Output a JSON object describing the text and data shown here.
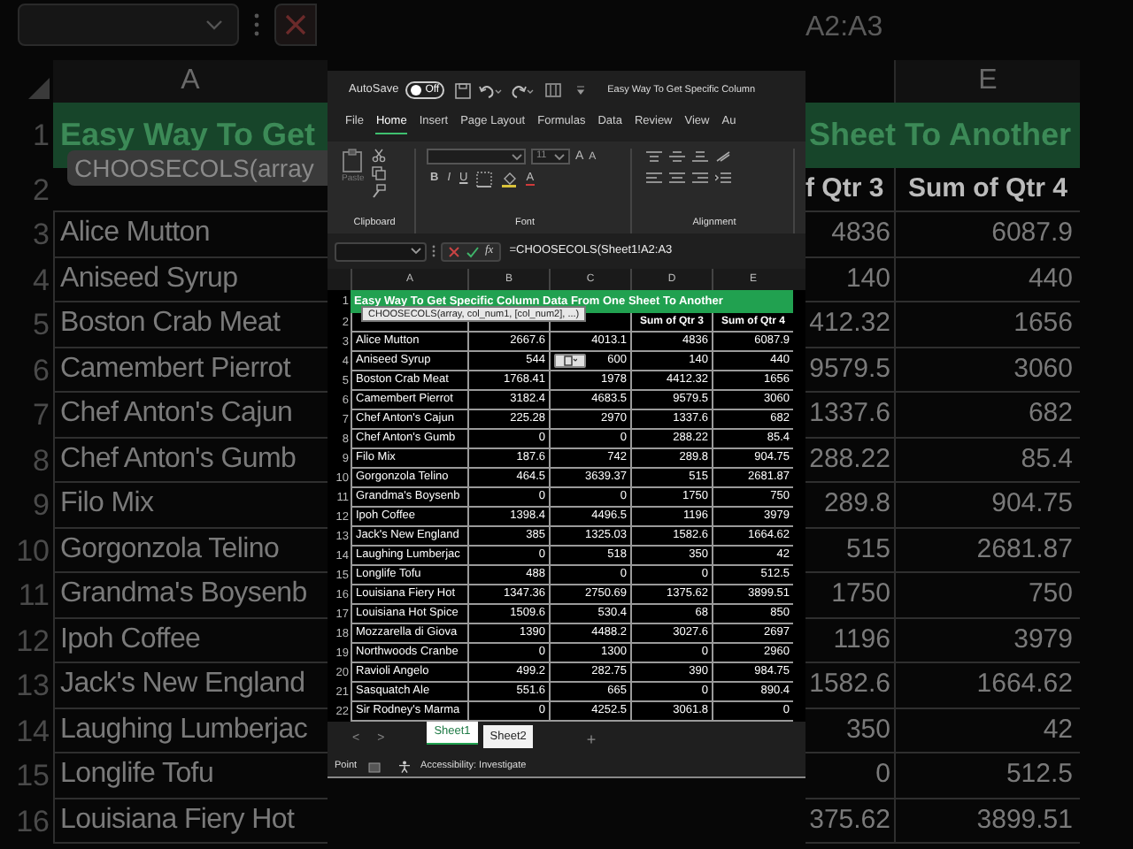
{
  "backdrop_left": {
    "column": "A",
    "banner": "Easy Way To Get",
    "tooltip": "CHOOSECOLS(array",
    "row_numbers": [
      "1",
      "2",
      "3",
      "4",
      "5",
      "6",
      "7",
      "8",
      "9",
      "10",
      "11",
      "12",
      "13",
      "14",
      "15",
      "16"
    ],
    "cells": [
      "Alice Mutton",
      "Aniseed Syrup",
      "Boston Crab Meat",
      "Camembert Pierrot",
      "Chef Anton's Cajun",
      "Chef Anton's Gumb",
      "Filo Mix",
      "Gorgonzola Telino",
      "Grandma's Boysenb",
      "Ipoh Coffee",
      "Jack's New England",
      "Laughing Lumberjac",
      "Longlife Tofu",
      "Louisiana Fiery Hot"
    ]
  },
  "backdrop_right": {
    "formula_tail": "A2:A3",
    "column": "E",
    "banner": "Sheet To Another",
    "headers": [
      "f Qtr 3",
      "Sum of Qtr 4"
    ],
    "rows": [
      [
        "4836",
        "6087.9"
      ],
      [
        "140",
        "440"
      ],
      [
        "412.32",
        "1656"
      ],
      [
        "9579.5",
        "3060"
      ],
      [
        "1337.6",
        "682"
      ],
      [
        "288.22",
        "85.4"
      ],
      [
        "289.8",
        "904.75"
      ],
      [
        "515",
        "2681.87"
      ],
      [
        "1750",
        "750"
      ],
      [
        "1196",
        "3979"
      ],
      [
        "1582.6",
        "1664.62"
      ],
      [
        "350",
        "42"
      ],
      [
        "0",
        "512.5"
      ],
      [
        "375.62",
        "3899.51"
      ]
    ]
  },
  "window": {
    "autosave_label": "AutoSave",
    "autosave": {
      "on": false,
      "label": "Off"
    },
    "title": "Easy Way To Get Specific Column"
  },
  "tabs": [
    {
      "label": "File",
      "selected": false
    },
    {
      "label": "Home",
      "selected": true
    },
    {
      "label": "Insert",
      "selected": false
    },
    {
      "label": "Page Layout",
      "selected": false
    },
    {
      "label": "Formulas",
      "selected": false
    },
    {
      "label": "Data",
      "selected": false
    },
    {
      "label": "Review",
      "selected": false
    },
    {
      "label": "View",
      "selected": false
    },
    {
      "label": "Au",
      "selected": false
    }
  ],
  "ribbon": {
    "groups": [
      "Clipboard",
      "Font",
      "Alignment"
    ],
    "paste_label": "Paste",
    "font_size": "11",
    "font_grow": "A",
    "font_shrink": "A",
    "format_buttons": [
      "B",
      "I",
      "U"
    ],
    "font_color": "A"
  },
  "formula_bar": {
    "fx_label": "fx",
    "formula": "=CHOOSECOLS(Sheet1!A2:A3"
  },
  "sheet": {
    "columns": [
      "A",
      "B",
      "C",
      "D",
      "E"
    ],
    "top_row_numbers": [
      "1",
      "2"
    ],
    "banner": "Easy Way To Get Specific Column Data From One Sheet To Another",
    "header_cells": [
      "Sum of Qtr 3",
      "Sum of Qtr 4"
    ],
    "tooltip": "CHOOSECOLS(array, col_num1, [col_num2], ...)",
    "rows": [
      {
        "n": "3",
        "cells": [
          "Alice Mutton",
          "2667.6",
          "4013.1",
          "4836",
          "6087.9"
        ]
      },
      {
        "n": "4",
        "cells": [
          "Aniseed Syrup",
          "544",
          "600",
          "140",
          "440"
        ]
      },
      {
        "n": "5",
        "cells": [
          "Boston Crab Meat",
          "1768.41",
          "1978",
          "4412.32",
          "1656"
        ]
      },
      {
        "n": "6",
        "cells": [
          "Camembert Pierrot",
          "3182.4",
          "4683.5",
          "9579.5",
          "3060"
        ]
      },
      {
        "n": "7",
        "cells": [
          "Chef Anton's Cajun",
          "225.28",
          "2970",
          "1337.6",
          "682"
        ]
      },
      {
        "n": "8",
        "cells": [
          "Chef Anton's Gumb",
          "0",
          "0",
          "288.22",
          "85.4"
        ]
      },
      {
        "n": "9",
        "cells": [
          "Filo Mix",
          "187.6",
          "742",
          "289.8",
          "904.75"
        ]
      },
      {
        "n": "10",
        "cells": [
          "Gorgonzola Telino",
          "464.5",
          "3639.37",
          "515",
          "2681.87"
        ]
      },
      {
        "n": "11",
        "cells": [
          "Grandma's Boysenb",
          "0",
          "0",
          "1750",
          "750"
        ]
      },
      {
        "n": "12",
        "cells": [
          "Ipoh Coffee",
          "1398.4",
          "4496.5",
          "1196",
          "3979"
        ]
      },
      {
        "n": "13",
        "cells": [
          "Jack's New England",
          "385",
          "1325.03",
          "1582.6",
          "1664.62"
        ]
      },
      {
        "n": "14",
        "cells": [
          "Laughing Lumberjac",
          "0",
          "518",
          "350",
          "42"
        ]
      },
      {
        "n": "15",
        "cells": [
          "Longlife Tofu",
          "488",
          "0",
          "0",
          "512.5"
        ]
      },
      {
        "n": "16",
        "cells": [
          "Louisiana Fiery Hot",
          "1347.36",
          "2750.69",
          "1375.62",
          "3899.51"
        ]
      },
      {
        "n": "17",
        "cells": [
          "Louisiana Hot Spice",
          "1509.6",
          "530.4",
          "68",
          "850"
        ]
      },
      {
        "n": "18",
        "cells": [
          "Mozzarella di Giova",
          "1390",
          "4488.2",
          "3027.6",
          "2697"
        ]
      },
      {
        "n": "19",
        "cells": [
          "Northwoods Cranbe",
          "0",
          "1300",
          "0",
          "2960"
        ]
      },
      {
        "n": "20",
        "cells": [
          "Ravioli Angelo",
          "499.2",
          "282.75",
          "390",
          "984.75"
        ]
      },
      {
        "n": "21",
        "cells": [
          "Sasquatch Ale",
          "551.6",
          "665",
          "0",
          "890.4"
        ]
      },
      {
        "n": "22",
        "cells": [
          "Sir Rodney's Marma",
          "0",
          "4252.5",
          "3061.8",
          "0"
        ]
      }
    ]
  },
  "sheet_nav": [
    "<",
    ">"
  ],
  "sheet_tabs": [
    {
      "label": "Sheet1",
      "selected": true
    },
    {
      "label": "Sheet2",
      "selected": false
    }
  ],
  "add_sheet": "+",
  "status_bar": {
    "mode": "Point",
    "accessibility": "Accessibility: Investigate"
  }
}
